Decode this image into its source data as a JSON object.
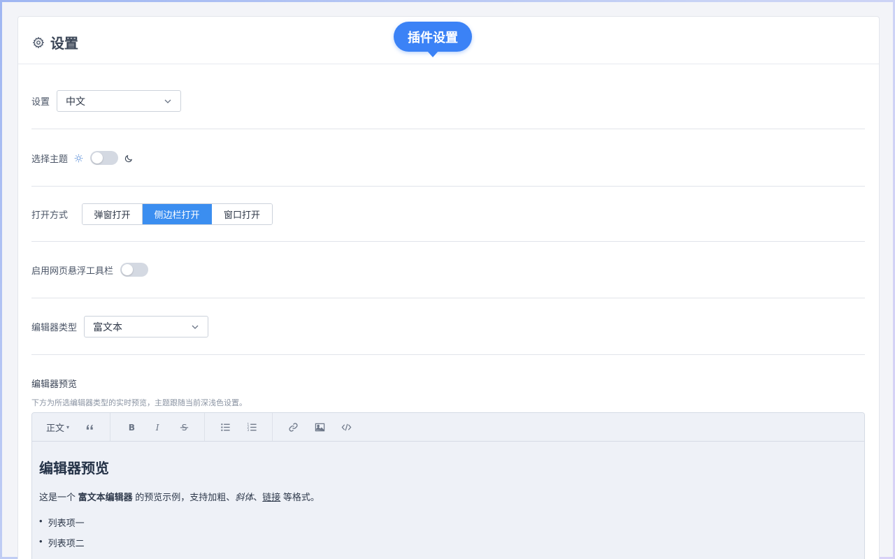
{
  "header": {
    "title": "设置",
    "icon": "gear-icon"
  },
  "bubble": {
    "text": "插件设置",
    "color": "#3b82f6"
  },
  "language": {
    "label": "设置",
    "value": "中文"
  },
  "theme": {
    "label": "选择主题",
    "light_icon": "sun-icon",
    "dark_icon": "moon-icon",
    "dark_enabled": false
  },
  "open_mode": {
    "label": "打开方式",
    "options": [
      "弹窗打开",
      "侧边栏打开",
      "窗口打开"
    ],
    "selected": "侧边栏打开",
    "accent": "#3b8ef0"
  },
  "floating_toolbar": {
    "label": "启用网页悬浮工具栏",
    "enabled": false
  },
  "editor_type": {
    "label": "编辑器类型",
    "value": "富文本"
  },
  "preview": {
    "title": "编辑器预览",
    "description": "下方为所选编辑器类型的实时预览，主题跟随当前深浅色设置。",
    "toolbar": {
      "heading": "正文",
      "icons": [
        "quote-icon",
        "bold-icon",
        "italic-icon",
        "strikethrough-icon",
        "bullet-list-icon",
        "numbered-list-icon",
        "link-icon",
        "image-icon",
        "code-icon"
      ]
    },
    "content": {
      "heading": "编辑器预览",
      "para_pre": "这是一个 ",
      "para_bold": "富文本编辑器",
      "para_mid": " 的预览示例，支持加粗、",
      "para_italic": "斜体",
      "para_sep": "、",
      "para_link": "链接",
      "para_post": " 等格式。",
      "list": [
        "列表项一",
        "列表项二"
      ]
    }
  }
}
